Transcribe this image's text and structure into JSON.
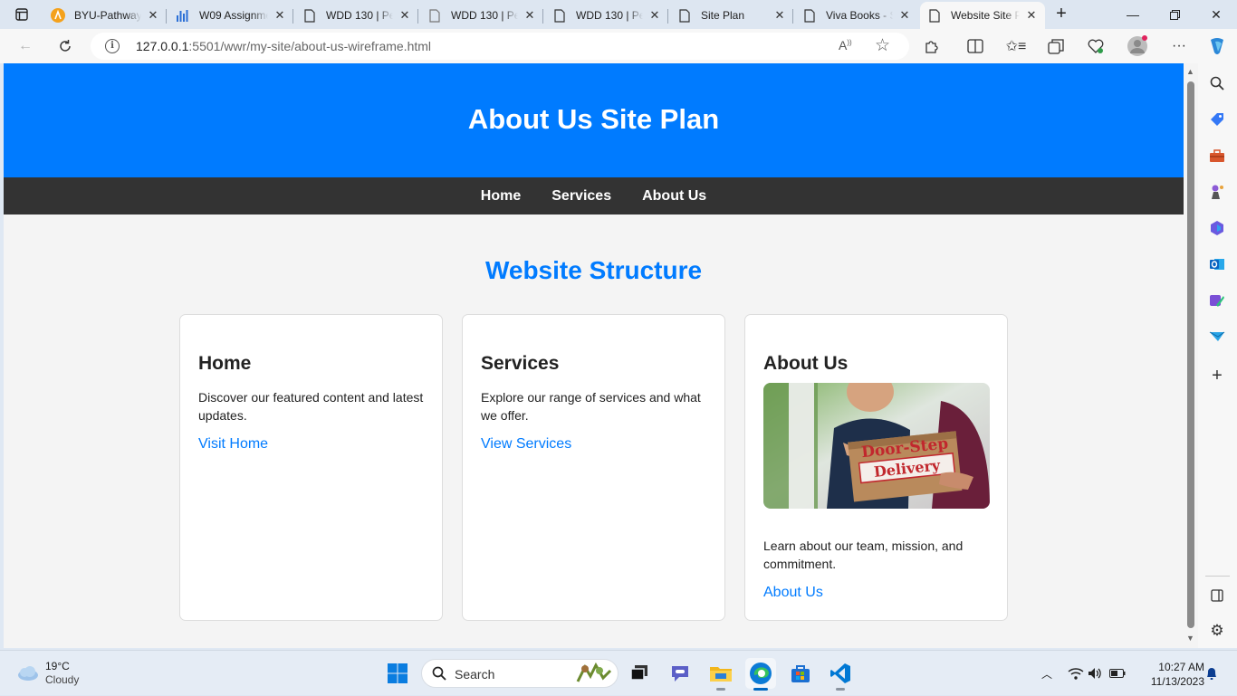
{
  "browser": {
    "tabs": [
      {
        "title": "BYU-Pathway",
        "icon": "pathway-logo-icon"
      },
      {
        "title": "W09 Assignment",
        "icon": "canvas-chart-icon"
      },
      {
        "title": "WDD 130 | Pe",
        "icon": "page-icon"
      },
      {
        "title": "WDD 130 | Pe",
        "icon": "page-icon"
      },
      {
        "title": "WDD 130 | Pe",
        "icon": "page-icon"
      },
      {
        "title": "Site Plan",
        "icon": "page-icon"
      },
      {
        "title": "Viva Books - S",
        "icon": "page-icon"
      },
      {
        "title": "Website Site P",
        "icon": "page-icon",
        "active": true
      }
    ],
    "address": {
      "host": "127.0.0.1",
      "rest": ":5501/wwr/my-site/about-us-wireframe.html"
    }
  },
  "page": {
    "header_title": "About Us Site Plan",
    "nav": [
      "Home",
      "Services",
      "About Us"
    ],
    "section_title": "Website Structure",
    "cards": [
      {
        "heading": "Home",
        "text": "Discover our featured content and latest updates.",
        "link": "Visit Home"
      },
      {
        "heading": "Services",
        "text": "Explore our range of services and what we offer.",
        "link": "View Services"
      },
      {
        "heading": "About Us",
        "image_text": [
          "Door-Step",
          "Delivery"
        ],
        "text": "Learn about our team, mission, and commitment.",
        "link": "About Us"
      }
    ]
  },
  "taskbar": {
    "weather": {
      "temp": "19°C",
      "condition": "Cloudy"
    },
    "search_placeholder": "Search",
    "time": "10:27 AM",
    "date": "11/13/2023"
  },
  "colors": {
    "accent": "#007bff",
    "nav": "#333333",
    "page_bg": "#f4f4f4"
  }
}
